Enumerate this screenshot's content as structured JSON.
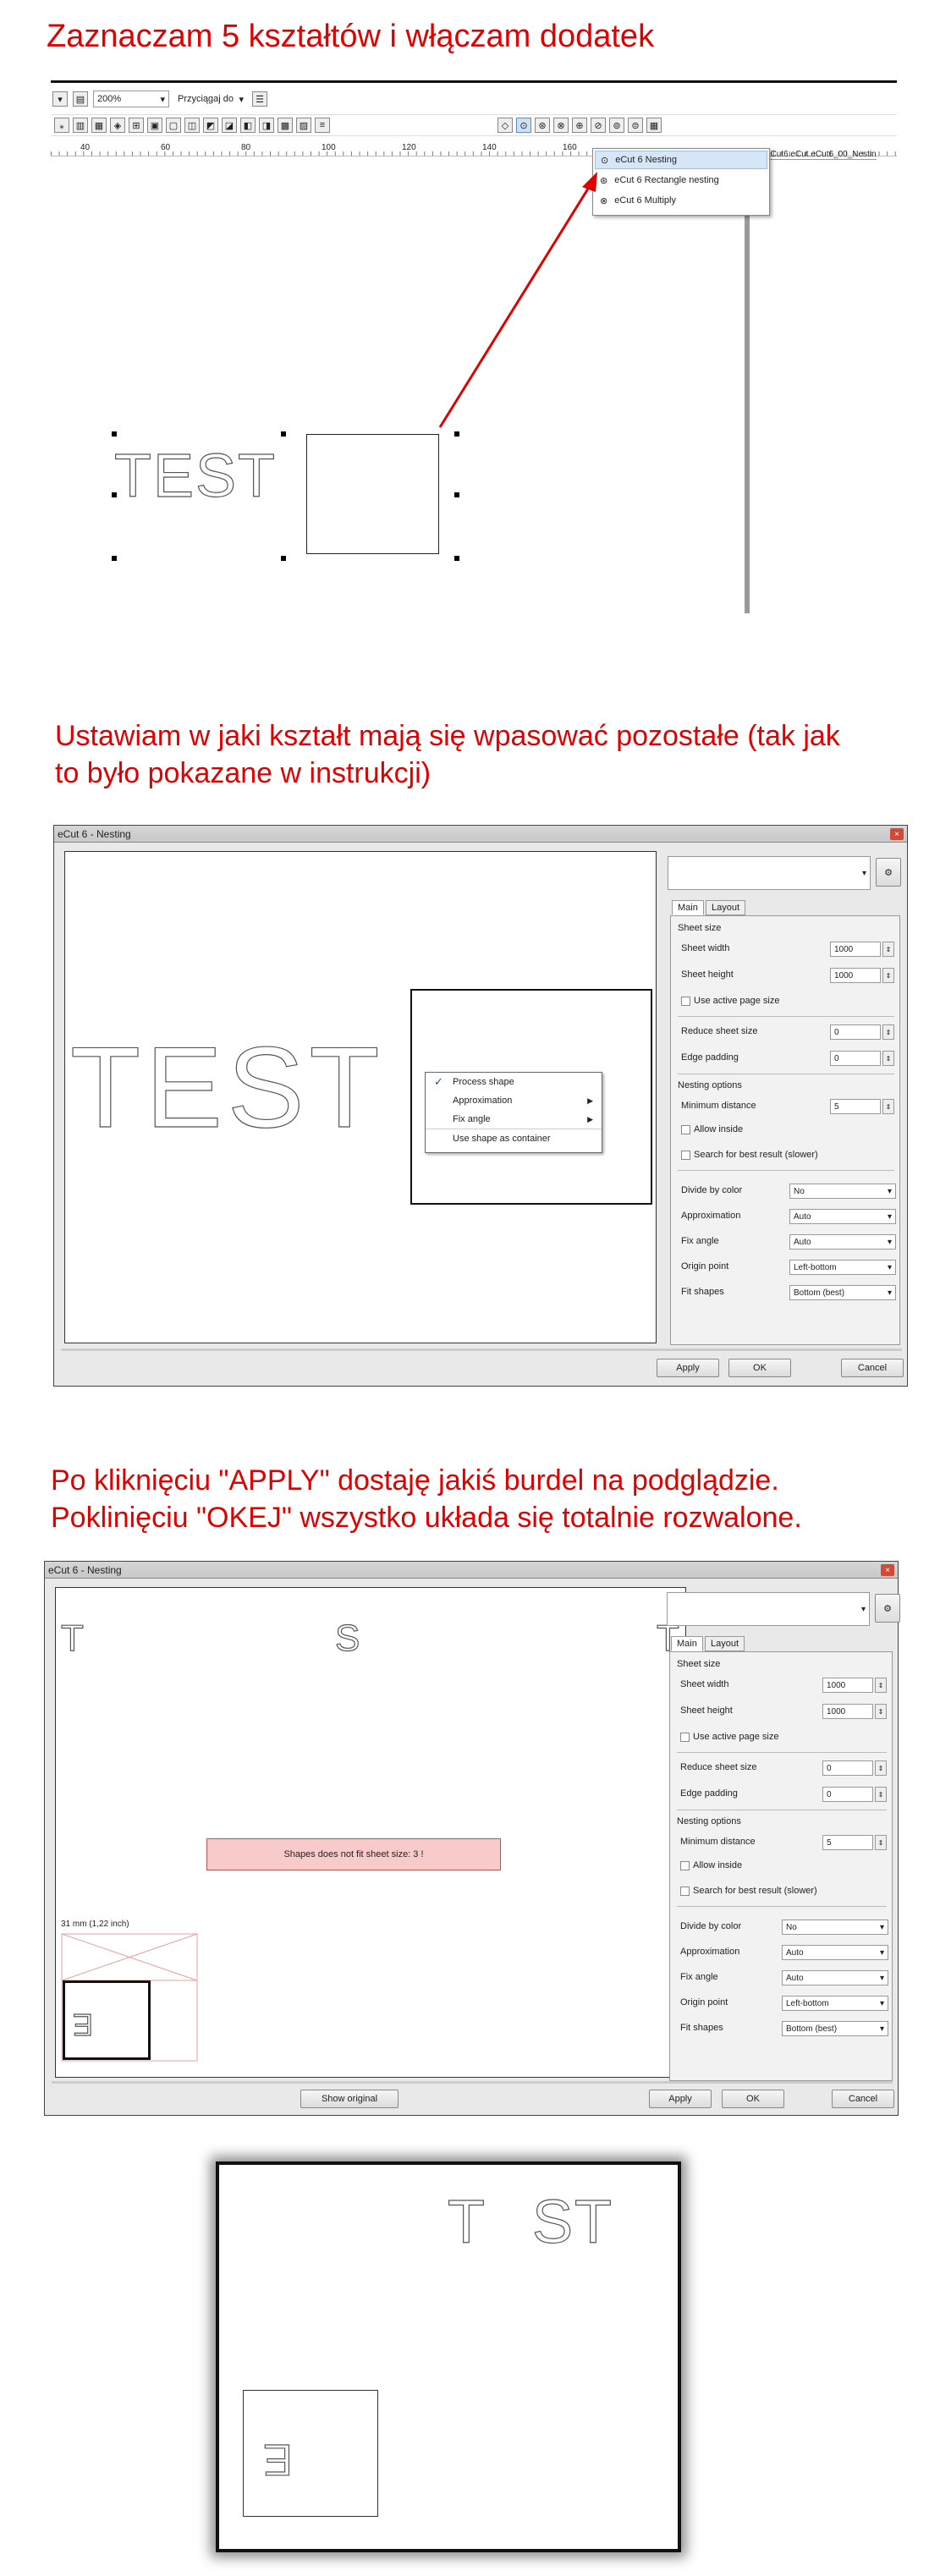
{
  "headings": {
    "step1": "Zaznaczam 5 kształtów i włączam dodatek",
    "step2_line1": "Ustawiam w jaki kształt mają się wpasować pozostałe (tak jak",
    "step2_line2": "to było pokazane w instrukcji)",
    "step3_line1": "Po kliknięciu \"APPLY\" dostaję jakiś burdel na podglądzie.",
    "step3_line2": "Poklinięciu \"OKEJ\" wszystko układa się totalnie rozwalone."
  },
  "toolbar": {
    "zoom": "200%",
    "snap_label": "Przyciągaj do",
    "ruler_labels": [
      "40",
      "60",
      "80",
      "100",
      "120",
      "140",
      "160"
    ]
  },
  "plugin_menu": {
    "items": [
      "eCut 6 Nesting",
      "eCut 6 Rectangle nesting",
      "eCut 6 Multiply"
    ],
    "file_label": "eCut6.eCut.eCut6_00_Nestin"
  },
  "canvas1": {
    "shape_text": "TEST"
  },
  "dialog": {
    "title": "eCut 6 - Nesting",
    "close": "×",
    "tabs": [
      "Main",
      "Layout"
    ],
    "sheet_size_label": "Sheet size",
    "sheet_width_label": "Sheet width",
    "sheet_width": "1000",
    "sheet_height_label": "Sheet height",
    "sheet_height": "1000",
    "use_active_page": "Use active page size",
    "reduce_sheet_label": "Reduce sheet size",
    "reduce_sheet": "0",
    "edge_padding_label": "Edge padding",
    "edge_padding": "0",
    "nesting_options_label": "Nesting options",
    "min_distance_label": "Minimum distance",
    "min_distance": "5",
    "allow_inside": "Allow inside",
    "search_best": "Search for best result (slower)",
    "divide_by_color_label": "Divide by color",
    "divide_by_color": "No",
    "approximation_label": "Approximation",
    "approximation": "Auto",
    "fix_angle_label": "Fix angle",
    "fix_angle": "Auto",
    "origin_point_label": "Origin point",
    "origin_point": "Left-bottom",
    "fit_shapes_label": "Fit shapes",
    "fit_shapes": "Bottom (best)",
    "apply": "Apply",
    "ok": "OK",
    "cancel": "Cancel",
    "show_original": "Show original"
  },
  "context_menu": {
    "items": [
      "Process shape",
      "Approximation",
      "Fix angle",
      "Use shape as container"
    ]
  },
  "preview2": {
    "text": "TEST"
  },
  "preview3": {
    "letter_t": "T",
    "letter_s": "S",
    "letter_e": "E",
    "error": "Shapes does not fit sheet size: 3 !",
    "dimension": "31 mm (1,22 inch)"
  },
  "result": {
    "letter_t": "T",
    "letters_st": "ST",
    "letter_e": "E"
  }
}
